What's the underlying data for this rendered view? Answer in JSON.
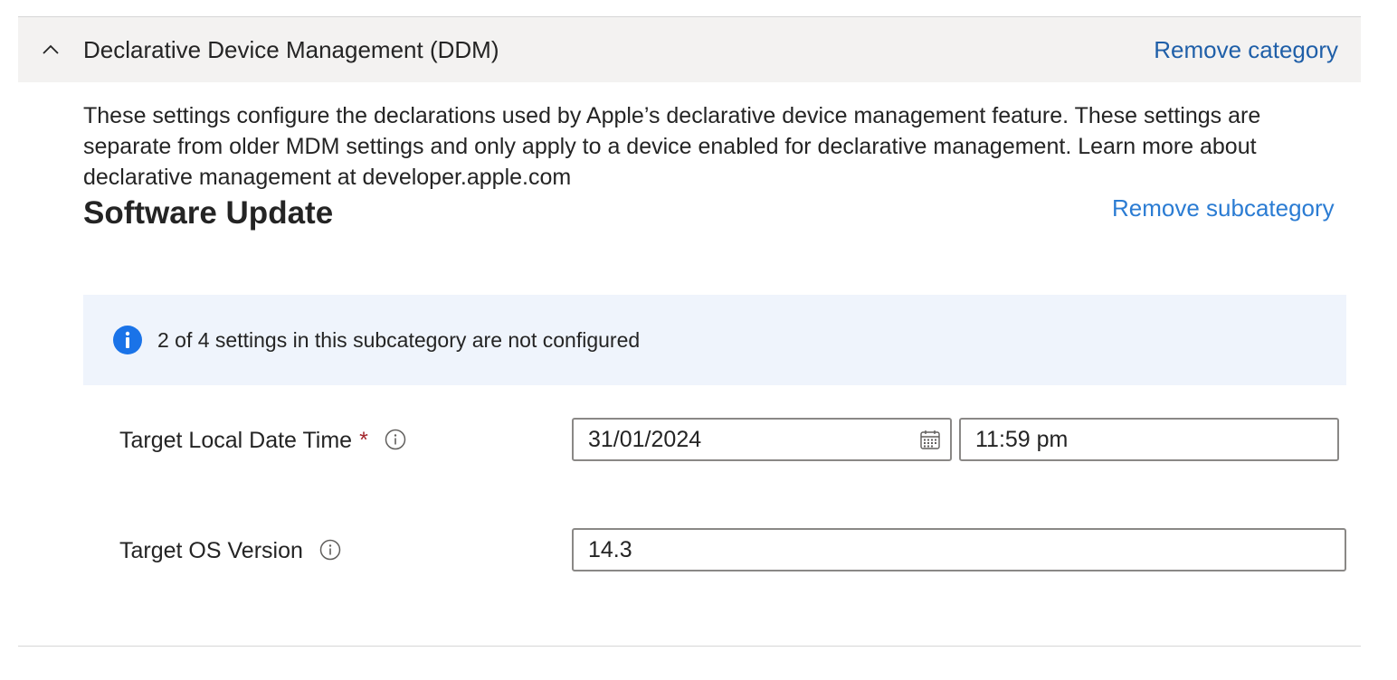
{
  "category": {
    "title": "Declarative Device Management (DDM)",
    "remove_label": "Remove category",
    "description": "These settings configure the declarations used by Apple’s declarative device management feature. These settings are separate from older MDM settings and only apply to a device enabled for declarative management. Learn more about declarative management at developer.apple.com"
  },
  "subcategory": {
    "title": "Software Update",
    "remove_label": "Remove subcategory",
    "info_banner": "2 of 4 settings in this subcategory are not configured"
  },
  "settings": [
    {
      "label": "Target Local Date Time",
      "required_marker": "*",
      "date_value": "31/01/2024",
      "time_value": "11:59 pm"
    },
    {
      "label": "Target OS Version",
      "value": "14.3"
    }
  ],
  "icons": {
    "chevron": "chevron-up-icon",
    "info": "info-filled-icon",
    "info_outline": "info-outline-icon",
    "calendar": "calendar-icon"
  },
  "colors": {
    "header_bg": "#f3f2f1",
    "link": "#2b7cd3",
    "info_banner_bg": "#eff4fc",
    "info_icon": "#1a73e8",
    "required": "#a4262c"
  }
}
